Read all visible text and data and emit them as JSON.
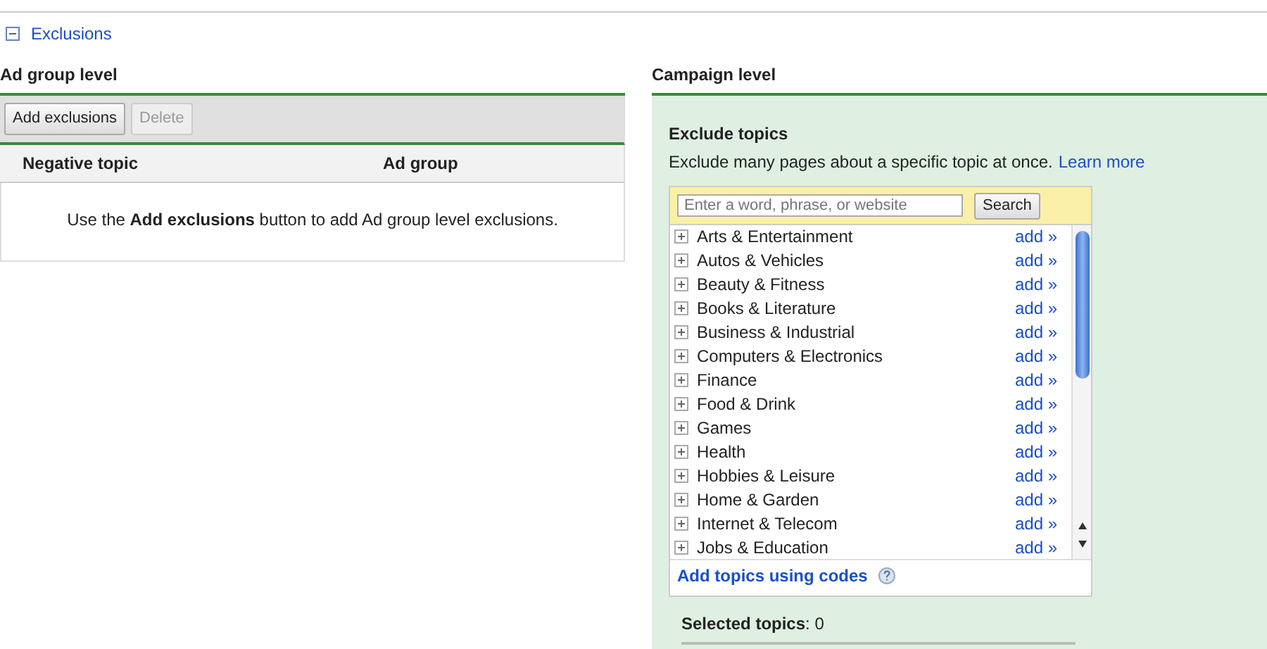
{
  "section": {
    "title": "Exclusions",
    "expanded": true
  },
  "ad_group_level": {
    "heading": "Ad group level",
    "buttons": [
      {
        "label": "Add exclusions",
        "disabled": false
      },
      {
        "label": "Delete",
        "disabled": true
      }
    ],
    "table": {
      "columns": [
        "Negative topic",
        "Ad group"
      ],
      "empty_message": "Use the **Add exclusions** button to add Ad group level exclusions."
    }
  },
  "campaign_level": {
    "heading": "Campaign level",
    "title": "Exclude topics",
    "description": "Exclude many pages about a specific topic at once.",
    "learn_more": "Learn more",
    "search": {
      "placeholder": "Enter a word, phrase, or website",
      "button": "Search"
    },
    "topics": [
      {
        "label": "Arts & Entertainment",
        "action": "add »"
      },
      {
        "label": "Autos & Vehicles",
        "action": "add »"
      },
      {
        "label": "Beauty & Fitness",
        "action": "add »"
      },
      {
        "label": "Books & Literature",
        "action": "add »"
      },
      {
        "label": "Business & Industrial",
        "action": "add »"
      },
      {
        "label": "Computers & Electronics",
        "action": "add »"
      },
      {
        "label": "Finance",
        "action": "add »"
      },
      {
        "label": "Food & Drink",
        "action": "add »"
      },
      {
        "label": "Games",
        "action": "add »"
      },
      {
        "label": "Health",
        "action": "add »"
      },
      {
        "label": "Hobbies & Leisure",
        "action": "add »"
      },
      {
        "label": "Home & Garden",
        "action": "add »"
      },
      {
        "label": "Internet & Telecom",
        "action": "add »"
      },
      {
        "label": "Jobs & Education",
        "action": "add »"
      }
    ],
    "codes_link": "Add topics using codes",
    "selected_topics": "**Selected topics**: 0"
  }
}
